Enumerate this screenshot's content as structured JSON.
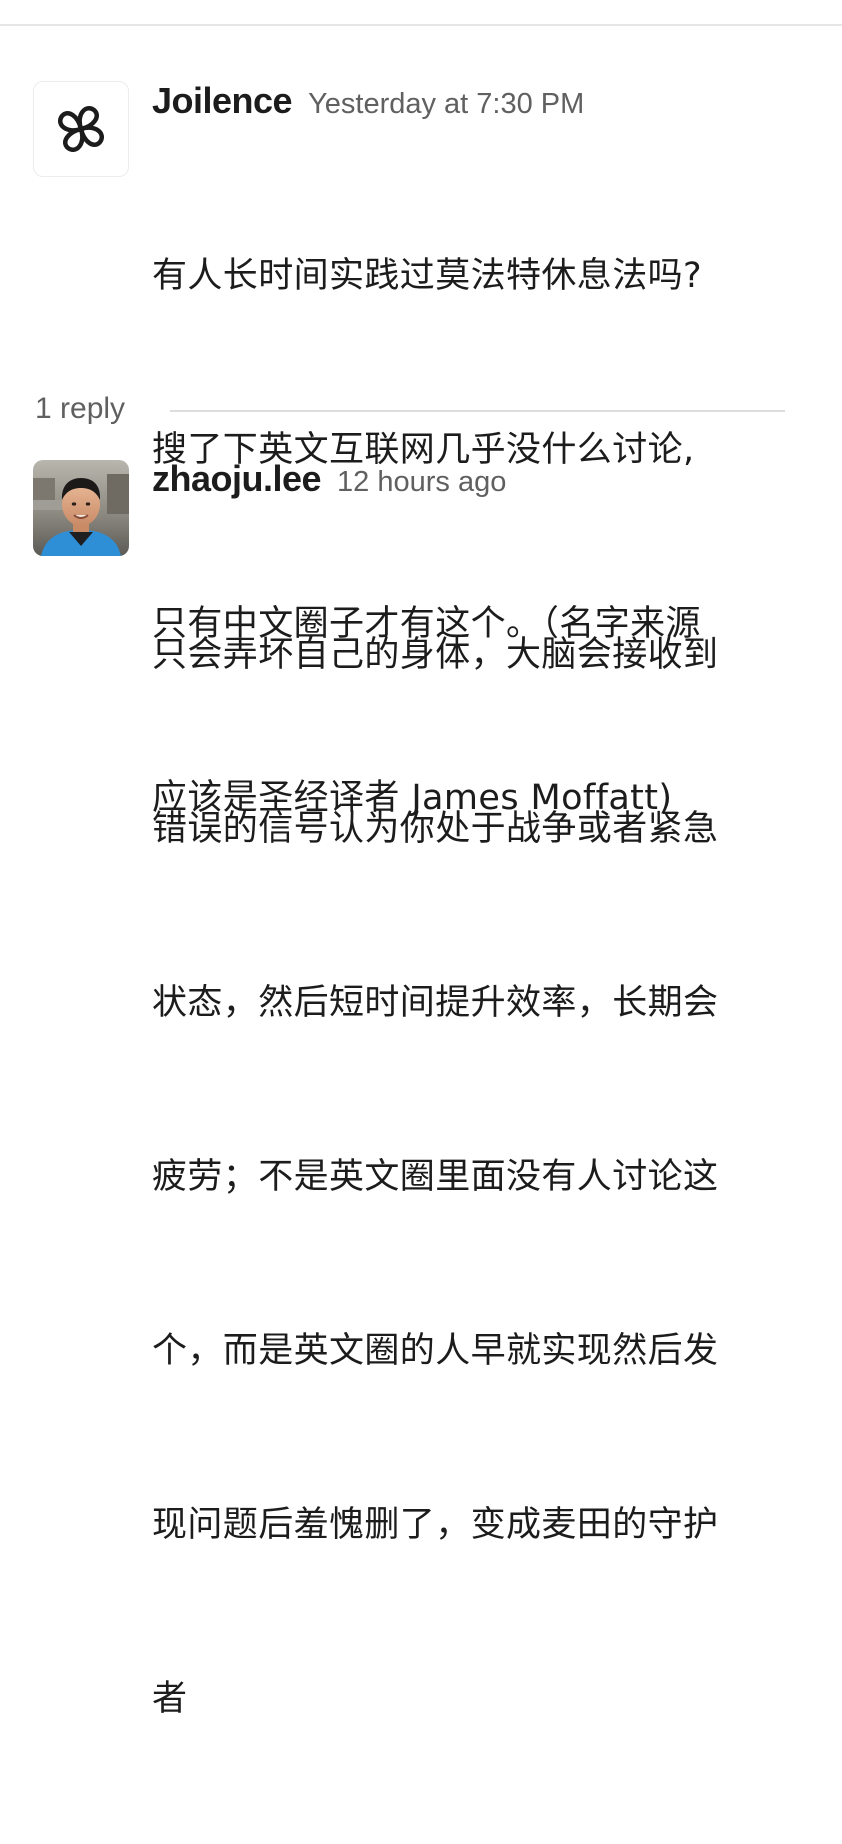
{
  "thread": {
    "parent": {
      "author": "Joilence",
      "timestamp": "Yesterday at 7:30 PM",
      "avatar_icon": "propeller-logo-icon",
      "lines": [
        "有人长时间实践过莫法特休息法吗?",
        "搜了下英文互联网几乎没什么讨论,",
        "只有中文圈子才有这个。（名字来源",
        "应该是圣经译者 James Moffatt)"
      ]
    },
    "replies_label": "1 reply",
    "reply": {
      "author": "zhaoju.lee",
      "timestamp": "12 hours ago",
      "avatar_icon": "user-photo-avatar",
      "lines": [
        "只会弄坏自己的身体，大脑会接收到",
        "错误的信号认为你处于战争或者紧急",
        "状态，然后短时间提升效率，长期会",
        "疲劳；不是英文圈里面没有人讨论这",
        "个，而是英文圈的人早就实现然后发",
        "现问题后羞愧删了，变成麦田的守护",
        "者"
      ]
    }
  }
}
